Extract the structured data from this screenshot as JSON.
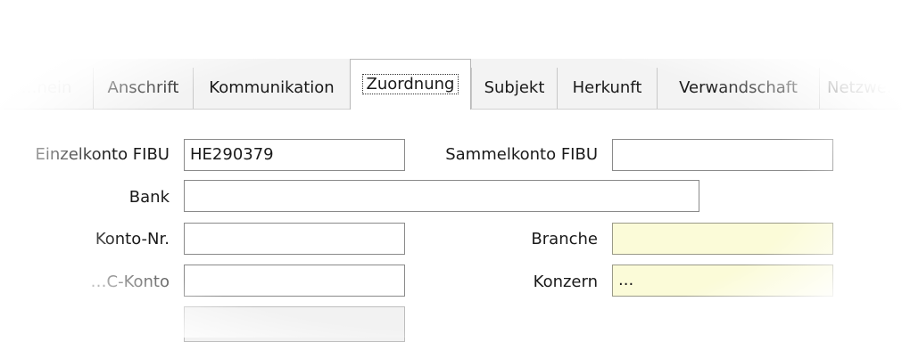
{
  "tabs": [
    {
      "label": "…nein",
      "active": false
    },
    {
      "label": "Anschrift",
      "active": false
    },
    {
      "label": "Kommunikation",
      "active": false
    },
    {
      "label": "Zuordnung",
      "active": true
    },
    {
      "label": "Subjekt",
      "active": false
    },
    {
      "label": "Herkunft",
      "active": false
    },
    {
      "label": "Verwandschaft",
      "active": false
    },
    {
      "label": "Netzwe…",
      "active": false
    }
  ],
  "form": {
    "einzelkonto_label": "Einzelkonto FIBU",
    "einzelkonto_value": "HE290379",
    "sammelkonto_label": "Sammelkonto FIBU",
    "sammelkonto_value": "",
    "bank_label": "Bank",
    "bank_value": "",
    "kontonr_label": "Konto-Nr.",
    "kontonr_value": "",
    "branche_label": "Branche",
    "branche_value": "",
    "oc_konto_label": "…C-Konto",
    "oc_konto_value": "",
    "konzern_label": "Konzern",
    "konzern_value": "...",
    "extra_field_value": ""
  },
  "colors": {
    "highlight_field": "#fbfbd8"
  }
}
